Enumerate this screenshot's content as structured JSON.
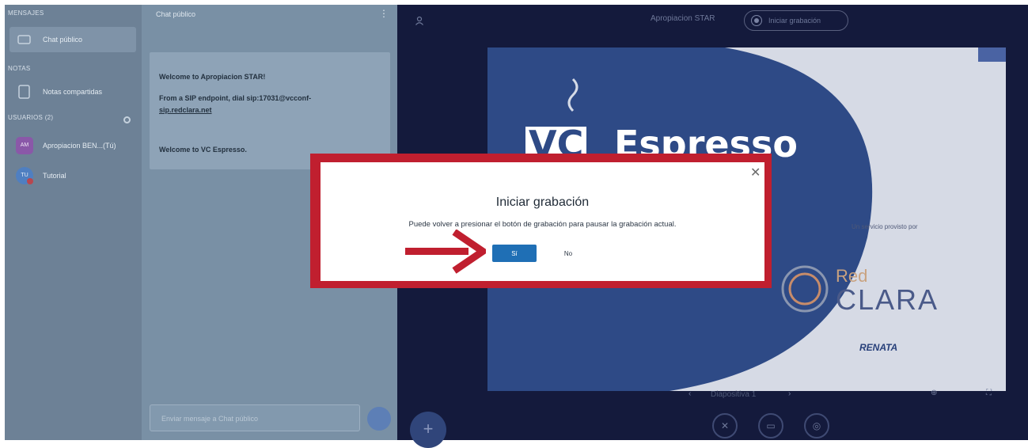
{
  "sidebar": {
    "messages_section": "MENSAJES",
    "public_chat": "Chat público",
    "notes_section": "NOTAS",
    "shared_notes": "Notas compartidas",
    "users_section": "USUARIOS (2)",
    "users": [
      {
        "initials": "AM",
        "name": "Apropiacion BEN...(Tú)"
      },
      {
        "initials": "TU",
        "name": "Tutorial"
      }
    ]
  },
  "chat": {
    "header_title": "Chat público",
    "messages": [
      "Welcome to Apropiacion STAR!",
      "From a SIP endpoint, dial sip:17031@vcconf-",
      "sip.redclara.net",
      "Welcome to VC Espresso."
    ],
    "input_placeholder": "Enviar mensaje a Chat público"
  },
  "topbar": {
    "meeting_title": "Apropiacion STAR",
    "record_label": "Iniciar grabación"
  },
  "slide": {
    "brand_prefix": "VC",
    "brand_word": "Espresso",
    "presented_by": "Un servicio provisto por",
    "partner": "CLARA",
    "partner_prefix": "Red",
    "renata": "RENATA",
    "page_label": "Diapositiva 1"
  },
  "modal": {
    "title": "Iniciar grabación",
    "body": "Puede volver a presionar el botón de grabación para pausar la grabación actual.",
    "yes_label": "Sí",
    "no_label": "No"
  },
  "colors": {
    "highlight_frame": "#c01f2f",
    "primary_button": "#1f6fb5",
    "dark_background": "#141a3c"
  }
}
